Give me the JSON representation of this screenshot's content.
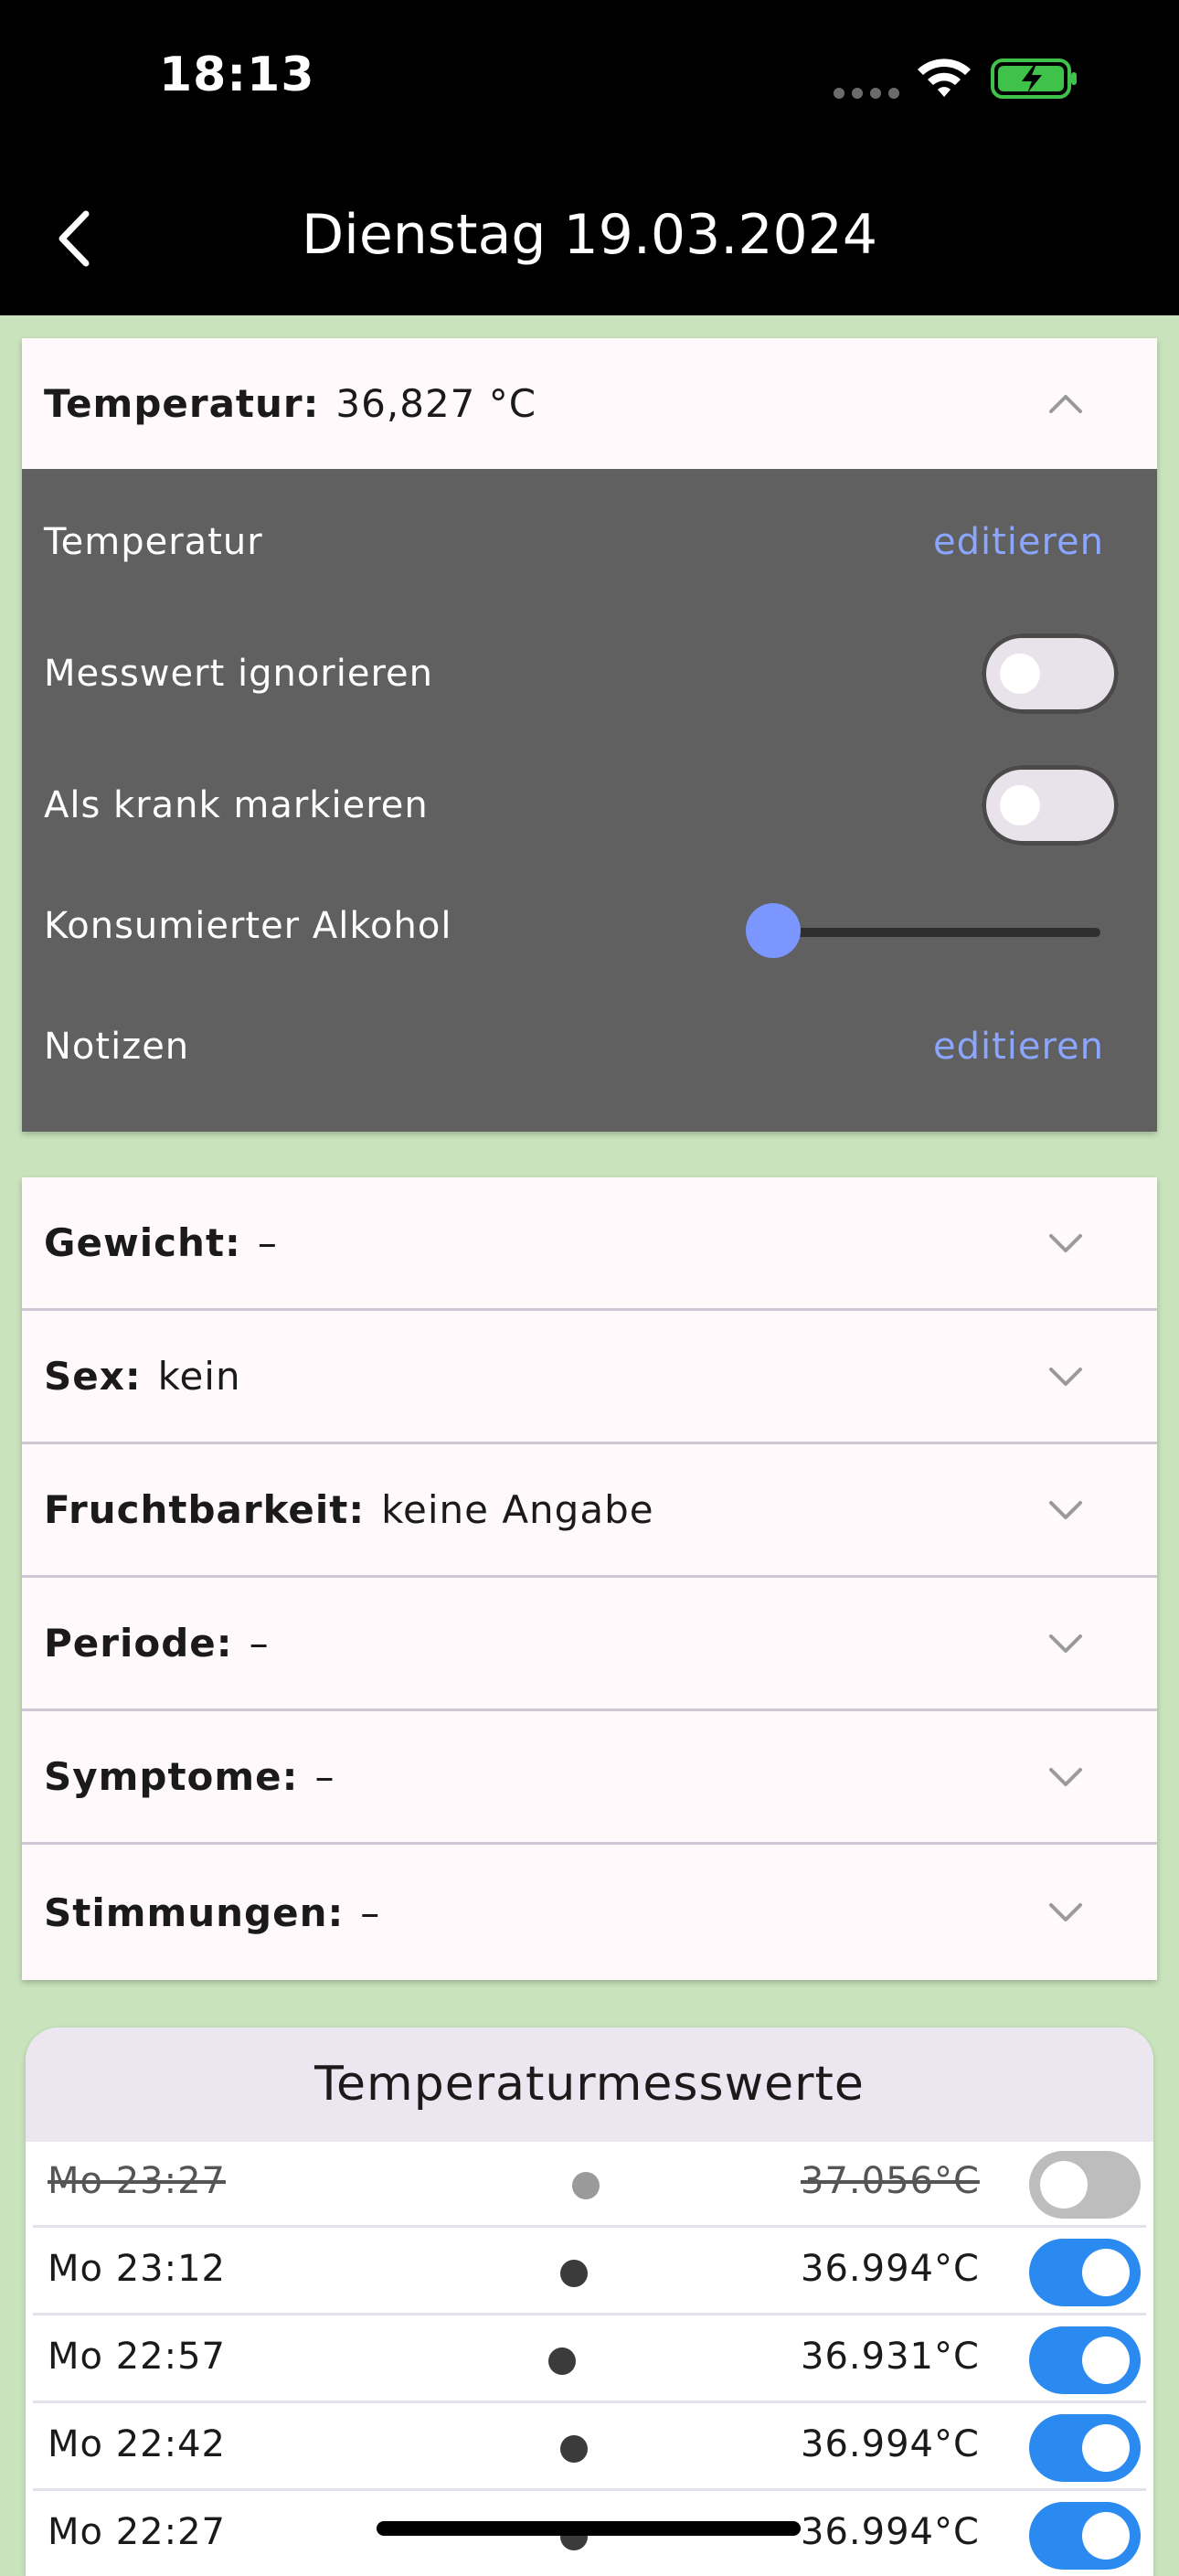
{
  "status_bar": {
    "time": "18:13"
  },
  "nav": {
    "title": "Dienstag 19.03.2024"
  },
  "temperature_card": {
    "label": "Temperatur:",
    "value": "36,827 °C",
    "rows": {
      "temperatur": {
        "label": "Temperatur",
        "action": "editieren"
      },
      "ignore": {
        "label": "Messwert ignorieren",
        "on": false
      },
      "sick": {
        "label": "Als krank markieren",
        "on": false
      },
      "alcohol": {
        "label": "Konsumierter Alkohol",
        "level": 0
      },
      "notes": {
        "label": "Notizen",
        "action": "editieren"
      }
    }
  },
  "sections": [
    {
      "label": "Gewicht:",
      "value": "–"
    },
    {
      "label": "Sex:",
      "value": "kein"
    },
    {
      "label": "Fruchtbarkeit:",
      "value": "keine Angabe"
    },
    {
      "label": "Periode:",
      "value": "–"
    },
    {
      "label": "Symptome:",
      "value": "–"
    },
    {
      "label": "Stimmungen:",
      "value": "–"
    }
  ],
  "measurements": {
    "title": "Temperaturmesswerte",
    "rows": [
      {
        "time": "Mo 23:27",
        "value": "37.056°C",
        "active": false
      },
      {
        "time": "Mo 23:12",
        "value": "36.994°C",
        "active": true
      },
      {
        "time": "Mo 22:57",
        "value": "36.931°C",
        "active": true
      },
      {
        "time": "Mo 22:42",
        "value": "36.994°C",
        "active": true
      },
      {
        "time": "Mo 22:27",
        "value": "36.994°C",
        "active": true
      }
    ]
  },
  "colors": {
    "background": "#c9e3bd",
    "accent_link": "#8aa6ff",
    "toggle_on": "#2b8af0",
    "slider": "#7b97ff"
  }
}
